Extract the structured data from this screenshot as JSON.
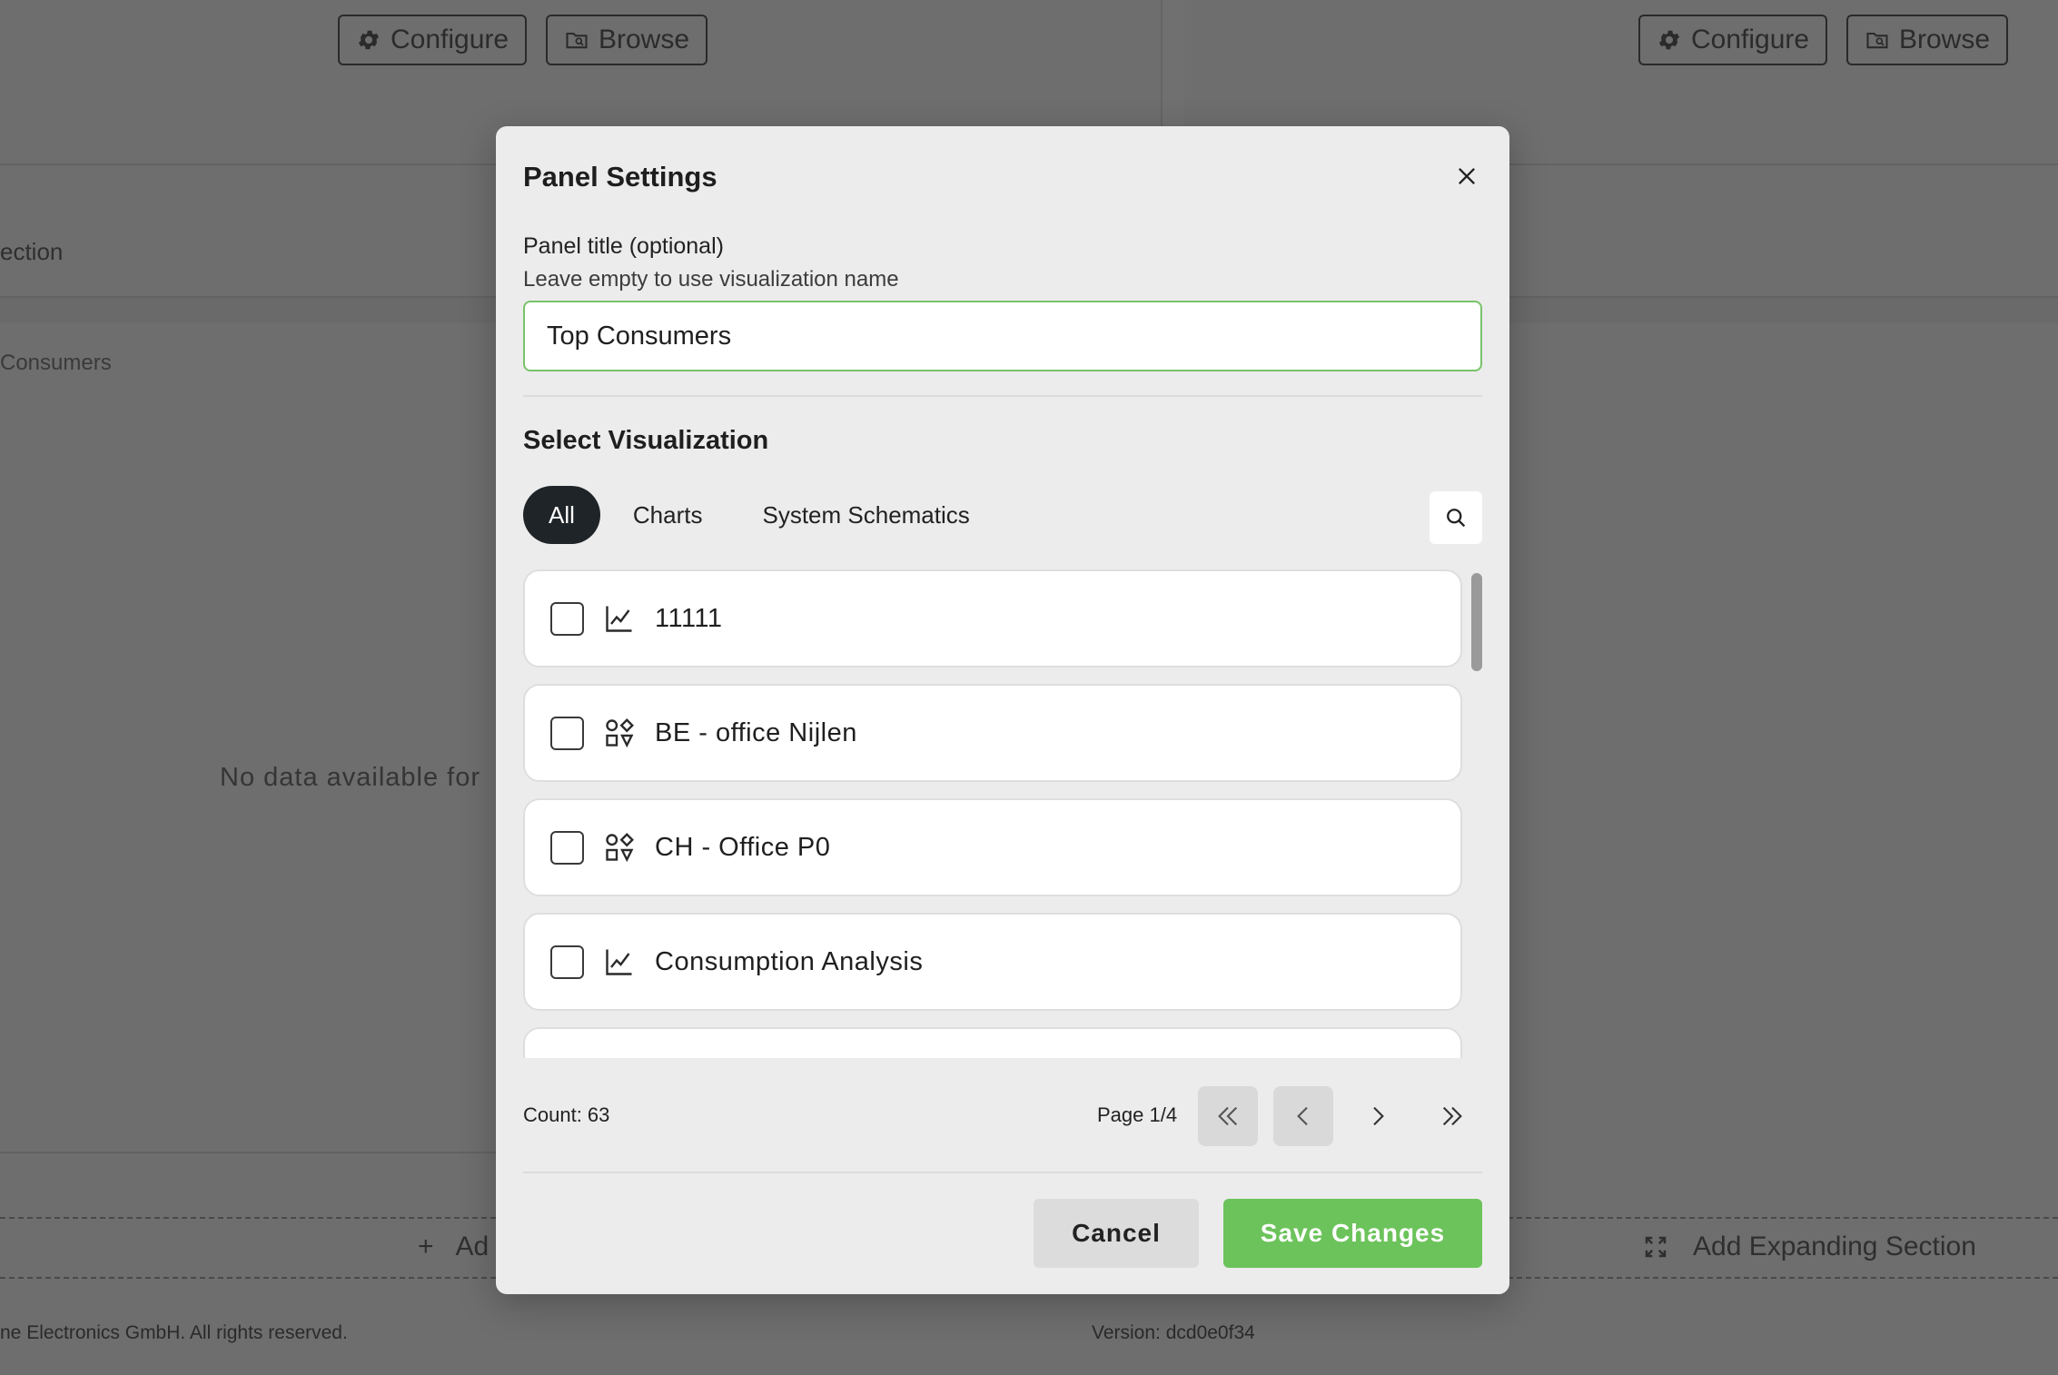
{
  "background": {
    "buttons": {
      "configure": "Configure",
      "browse": "Browse"
    },
    "section_label": "ection",
    "panel_label": "Consumers",
    "no_data": "No data available for",
    "add_section": "Ad",
    "add_expanding": "Add Expanding Section",
    "copyright": "ne Electronics GmbH. All rights reserved.",
    "version": "Version: dcd0e0f34"
  },
  "modal": {
    "title": "Panel Settings",
    "field_label": "Panel title (optional)",
    "field_hint": "Leave empty to use visualization name",
    "title_value": "Top Consumers",
    "section_title": "Select Visualization",
    "tabs": [
      {
        "label": "All",
        "active": true
      },
      {
        "label": "Charts",
        "active": false
      },
      {
        "label": "System Schematics",
        "active": false
      }
    ],
    "items": [
      {
        "label": "11111",
        "icon": "line-chart-icon"
      },
      {
        "label": "BE - office Nijlen",
        "icon": "schematic-icon"
      },
      {
        "label": "CH - Office P0",
        "icon": "schematic-icon"
      },
      {
        "label": "Consumption Analysis",
        "icon": "line-chart-icon"
      }
    ],
    "count": "Count: 63",
    "page": "Page 1/4",
    "cancel": "Cancel",
    "save": "Save Changes"
  }
}
